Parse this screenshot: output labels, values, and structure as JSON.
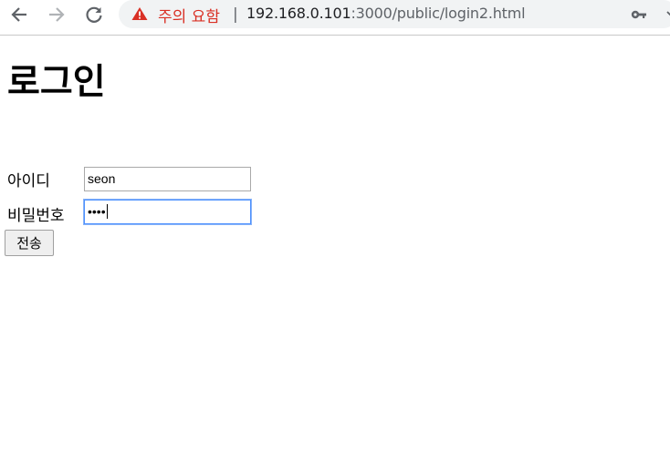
{
  "browser": {
    "security_warning": "주의 요함",
    "separator": "|",
    "url_host": "192.168.0.101",
    "url_rest": ":3000/public/login2.html",
    "icons": [
      "back-icon",
      "forward-icon",
      "reload-icon",
      "warning-icon",
      "key-icon",
      "more-icon"
    ],
    "warning_color": "#d93025"
  },
  "page": {
    "title": "로그인",
    "form": {
      "id_label": "아이디",
      "id_value": "seon",
      "password_label": "비밀번호",
      "password_value": "••••",
      "submit_label": "전송"
    }
  }
}
